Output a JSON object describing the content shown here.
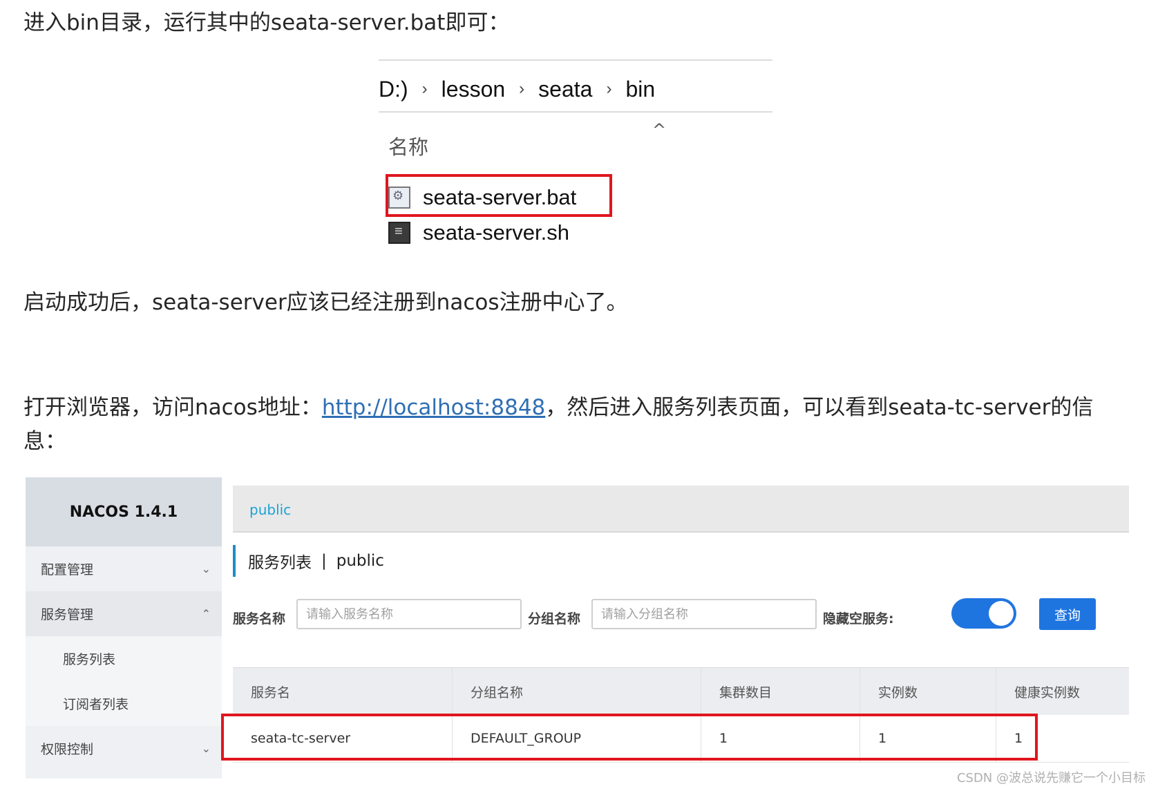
{
  "paragraphs": {
    "p1": "进入bin目录，运行其中的seata-server.bat即可：",
    "p2": "启动成功后，seata-server应该已经注册到nacos注册中心了。",
    "p3_before": "打开浏览器，访问nacos地址：",
    "p3_link": "http://localhost:8848",
    "p3_after": "，然后进入服务列表页面，可以看到seata-tc-server的信",
    "p3_line2": "息："
  },
  "explorer": {
    "breadcrumbs": [
      "D:)",
      "lesson",
      "seata",
      "bin"
    ],
    "breadcrumb_separator": "›",
    "sort_indicator": "^",
    "column_header": "名称",
    "files": [
      {
        "name": "seata-server.bat",
        "icon": "batch-file-icon",
        "highlighted": true
      },
      {
        "name": "seata-server.sh",
        "icon": "script-file-icon",
        "highlighted": false
      }
    ]
  },
  "nacos": {
    "brand": "NACOS 1.4.1",
    "sidebar": [
      {
        "label": "配置管理",
        "chevron": "⌄"
      },
      {
        "label": "服务管理",
        "chevron": "⌃"
      },
      {
        "label": "服务列表"
      },
      {
        "label": "订阅者列表"
      },
      {
        "label": "权限控制",
        "chevron": "⌄"
      }
    ],
    "namespace": "public",
    "page_title": "服务列表",
    "page_title_sep": "|",
    "page_title_ns": "public",
    "filters": {
      "service_label": "服务名称",
      "service_placeholder": "请输入服务名称",
      "group_label": "分组名称",
      "group_placeholder": "请输入分组名称",
      "hide_empty_label": "隐藏空服务:",
      "hide_empty_on": true,
      "query_button": "查询"
    },
    "table": {
      "headers": [
        "服务名",
        "分组名称",
        "集群数目",
        "实例数",
        "健康实例数"
      ],
      "rows": [
        [
          "seata-tc-server",
          "DEFAULT_GROUP",
          "1",
          "1",
          "1"
        ]
      ]
    }
  },
  "watermark": "CSDN @波总说先赚它一个小目标",
  "colors": {
    "highlight_red": "#e0161e",
    "link_blue": "#2f6fb4",
    "nacos_primary": "#1f75e0",
    "namespace_blue": "#1aa3d5"
  }
}
